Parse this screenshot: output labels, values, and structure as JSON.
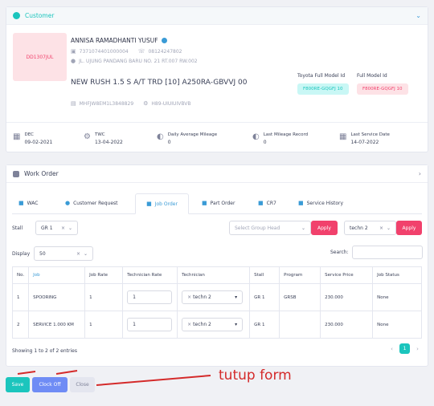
{
  "customer": {
    "section_title": "Customer",
    "plate": "DD1307JUL",
    "name": "ANNISA RAMADHANTI YUSUF",
    "id_number": "7371074401000004",
    "phone": "08124247802",
    "address": "JL. UJUNG PANDANG BARU NO. 21 RT.007 RW.002",
    "vehicle": "NEW RUSH 1.5 S A/T TRD [10] A250RA-GBVVJ 00",
    "vin": "MHFJW8EM1L3848829",
    "engine": "H89-UIUIUIVBVB",
    "toyota_model_label": "Toyota Full Model Id",
    "toyota_model_value": "F800RE-GQGFJ 10",
    "full_model_label": "Full Model Id",
    "full_model_value": "F800RE-GQGFJ 10",
    "stats": [
      {
        "label": "DEC",
        "value": "09-02-2021",
        "icon": "calendar-icon"
      },
      {
        "label": "TWC",
        "value": "13-04-2022",
        "icon": "settings-icon"
      },
      {
        "label": "Daily Average Mileage",
        "value": "0",
        "icon": "gauge-icon"
      },
      {
        "label": "Last Mileage Record",
        "value": "0",
        "icon": "gauge-icon"
      },
      {
        "label": "Last Service Date",
        "value": "14-07-2022",
        "icon": "calendar-icon"
      }
    ]
  },
  "work_order": {
    "section_title": "Work Order",
    "tabs": [
      "WAC",
      "Customer Request",
      "Job Order",
      "Part Order",
      "CR7",
      "Service History"
    ],
    "active_tab": "Job Order",
    "stall_label": "Stall",
    "stall_value": "GR 1",
    "group_head_placeholder": "Select Group Head",
    "apply_label": "Apply",
    "technician_value": "techn 2",
    "display_label": "Display",
    "display_value": "50",
    "search_label": "Search:",
    "columns": [
      "No.",
      "Job",
      "Job Rate",
      "Technician Rate",
      "Technician",
      "Stall",
      "Program",
      "Service Price",
      "Job Status"
    ],
    "rows": [
      {
        "no": "1",
        "job": "SPOORING",
        "job_rate": "1",
        "tech_rate": "1",
        "technician": "techn 2",
        "stall": "GR 1",
        "program": "GRSB",
        "price": "230.000",
        "status": "None"
      },
      {
        "no": "2",
        "job": "SERVICE 1.000 KM",
        "job_rate": "1",
        "tech_rate": "1",
        "technician": "techn 2",
        "stall": "GR 1",
        "program": "",
        "price": "230.000",
        "status": "None"
      }
    ],
    "entries_info": "Showing 1 to 2 of 2 entries",
    "current_page": "1"
  },
  "actions": {
    "save": "Save",
    "clock_off": "Clock Off",
    "close": "Close"
  },
  "annotation": {
    "text": "tutup form",
    "color": "#d42a2a"
  },
  "colors": {
    "accent": "#1bc5bd",
    "danger": "#f1416c",
    "primary": "#3a9bd6",
    "clock_off": "#6f8cf5"
  }
}
